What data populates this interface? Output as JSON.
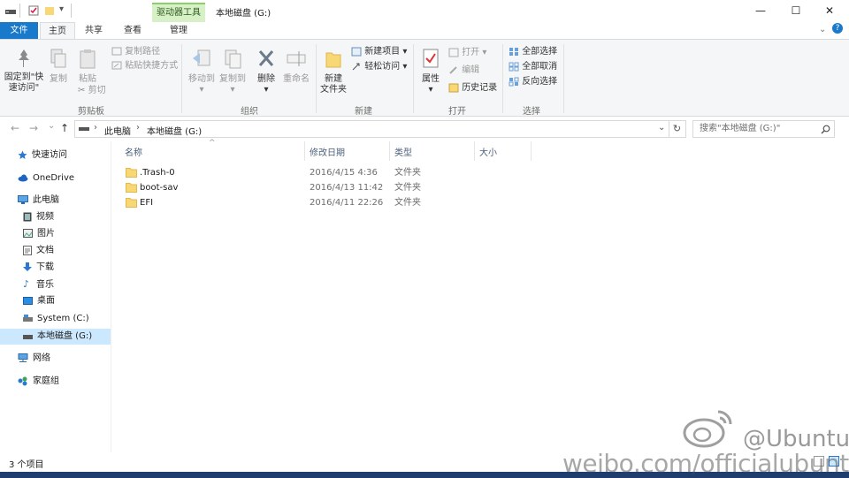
{
  "window": {
    "title": "本地磁盘 (G:)",
    "context_tab_group": "驱动器工具",
    "controls": {
      "minimize": "—",
      "maximize": "☐",
      "close": "✕"
    },
    "help": "?"
  },
  "ribbon_tabs": [
    {
      "label": "文件"
    },
    {
      "label": "主页"
    },
    {
      "label": "共享"
    },
    {
      "label": "查看"
    },
    {
      "label": "管理"
    }
  ],
  "ribbon": {
    "clipboard": {
      "label": "剪贴板",
      "pin_quick_access_line1": "固定到\"快",
      "pin_quick_access_line2": "速访问\"",
      "copy": "复制",
      "paste": "粘贴",
      "copy_path": "复制路径",
      "paste_shortcut": "粘贴快捷方式",
      "cut": "剪切"
    },
    "organize": {
      "label": "组织",
      "move_to": "移动到",
      "copy_to": "复制到",
      "delete": "删除",
      "rename": "重命名"
    },
    "new": {
      "label": "新建",
      "new_folder_line1": "新建",
      "new_folder_line2": "文件夹",
      "new_item": "新建项目",
      "easy_access": "轻松访问"
    },
    "open": {
      "label": "打开",
      "properties": "属性",
      "open": "打开",
      "edit": "编辑",
      "history": "历史记录"
    },
    "select": {
      "label": "选择",
      "select_all": "全部选择",
      "select_none": "全部取消",
      "invert": "反向选择"
    }
  },
  "address": {
    "back": "←",
    "forward": "→",
    "recent": "⌄",
    "up": "↑",
    "crumb_this_pc": "此电脑",
    "crumb_drive": "本地磁盘 (G:)",
    "search_placeholder": "搜索\"本地磁盘 (G:)\""
  },
  "nav_pane": {
    "items": [
      {
        "label": "快速访问",
        "icon": "star-icon"
      },
      {
        "label": "OneDrive",
        "icon": "cloud-icon"
      },
      {
        "label": "此电脑",
        "icon": "computer-icon"
      },
      {
        "label": "视频",
        "icon": "video-icon"
      },
      {
        "label": "图片",
        "icon": "picture-icon"
      },
      {
        "label": "文档",
        "icon": "document-icon"
      },
      {
        "label": "下载",
        "icon": "download-icon"
      },
      {
        "label": "音乐",
        "icon": "music-icon"
      },
      {
        "label": "桌面",
        "icon": "desktop-icon"
      },
      {
        "label": "System (C:)",
        "icon": "drive-icon"
      },
      {
        "label": "本地磁盘 (G:)",
        "icon": "drive-icon"
      },
      {
        "label": "网络",
        "icon": "network-icon"
      },
      {
        "label": "家庭组",
        "icon": "homegroup-icon"
      }
    ]
  },
  "file_list": {
    "columns": [
      "名称",
      "修改日期",
      "类型",
      "大小"
    ],
    "rows": [
      {
        "name": ".Trash-0",
        "modified": "2016/4/15 4:36",
        "type": "文件夹"
      },
      {
        "name": "boot-sav",
        "modified": "2016/4/13 11:42",
        "type": "文件夹"
      },
      {
        "name": "EFI",
        "modified": "2016/4/11 22:26",
        "type": "文件夹"
      }
    ]
  },
  "status": {
    "item_count": "3 个项目"
  },
  "watermark": {
    "handle": "@Ubuntu",
    "url": "weibo.com/officialubuntu"
  },
  "colors": {
    "accent": "#1979ca",
    "folder": "#f8d775",
    "selected": "#cce8ff",
    "context": "#d8f0c8"
  }
}
